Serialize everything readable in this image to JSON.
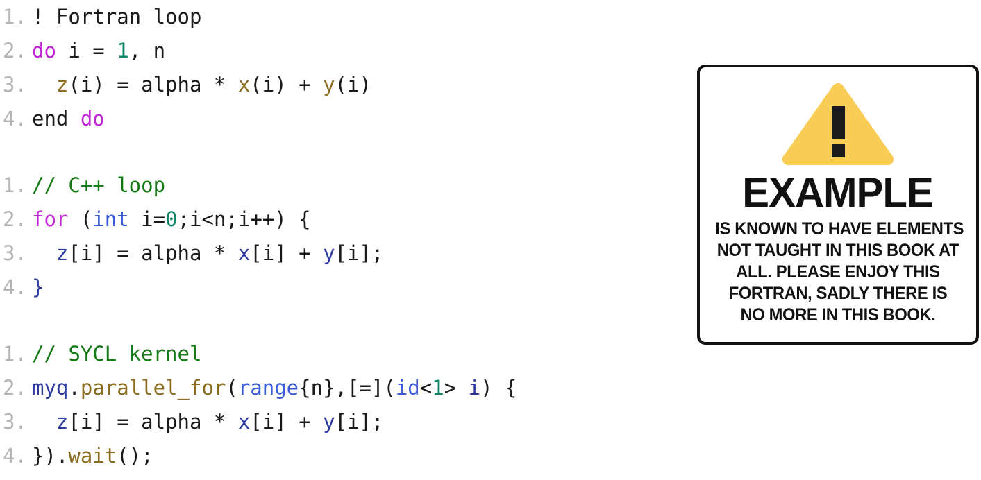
{
  "code": {
    "blocks": [
      {
        "name": "fortran-snippet",
        "language": "Fortran",
        "lines": [
          {
            "num": "1.",
            "tokens": [
              {
                "text": "! Fortran loop",
                "kind": "plain"
              }
            ]
          },
          {
            "num": "2.",
            "tokens": [
              {
                "text": "do",
                "kind": "keyword"
              },
              {
                "text": " i = ",
                "kind": "plain"
              },
              {
                "text": "1",
                "kind": "number"
              },
              {
                "text": ", n",
                "kind": "plain"
              }
            ]
          },
          {
            "num": "3.",
            "tokens": [
              {
                "text": "  ",
                "kind": "plain"
              },
              {
                "text": "z",
                "kind": "var-gold"
              },
              {
                "text": "(i) = alpha * ",
                "kind": "plain"
              },
              {
                "text": "x",
                "kind": "var-gold"
              },
              {
                "text": "(i) + ",
                "kind": "plain"
              },
              {
                "text": "y",
                "kind": "var-gold"
              },
              {
                "text": "(i)",
                "kind": "plain"
              }
            ]
          },
          {
            "num": "4.",
            "tokens": [
              {
                "text": "end ",
                "kind": "plain"
              },
              {
                "text": "do",
                "kind": "keyword"
              }
            ]
          }
        ]
      },
      {
        "name": "cpp-snippet",
        "language": "C++",
        "lines": [
          {
            "num": "1.",
            "tokens": [
              {
                "text": "// C++ loop",
                "kind": "comment"
              }
            ]
          },
          {
            "num": "2.",
            "tokens": [
              {
                "text": "for",
                "kind": "keyword"
              },
              {
                "text": " (",
                "kind": "plain"
              },
              {
                "text": "int",
                "kind": "type"
              },
              {
                "text": " i=",
                "kind": "plain"
              },
              {
                "text": "0",
                "kind": "number"
              },
              {
                "text": ";i<n;i++) {",
                "kind": "plain"
              }
            ]
          },
          {
            "num": "3.",
            "tokens": [
              {
                "text": "  ",
                "kind": "plain"
              },
              {
                "text": "z",
                "kind": "var-blue"
              },
              {
                "text": "[i] = alpha * ",
                "kind": "plain"
              },
              {
                "text": "x",
                "kind": "var-blue"
              },
              {
                "text": "[i] + ",
                "kind": "plain"
              },
              {
                "text": "y",
                "kind": "var-blue"
              },
              {
                "text": "[i];",
                "kind": "plain"
              }
            ]
          },
          {
            "num": "4.",
            "tokens": [
              {
                "text": "}",
                "kind": "punc-blue"
              }
            ]
          }
        ]
      },
      {
        "name": "sycl-snippet",
        "language": "SYCL",
        "lines": [
          {
            "num": "1.",
            "tokens": [
              {
                "text": "// SYCL kernel",
                "kind": "comment"
              }
            ]
          },
          {
            "num": "2.",
            "tokens": [
              {
                "text": "myq",
                "kind": "var-blue"
              },
              {
                "text": ".",
                "kind": "plain"
              },
              {
                "text": "parallel_for",
                "kind": "func"
              },
              {
                "text": "(",
                "kind": "plain"
              },
              {
                "text": "range",
                "kind": "type"
              },
              {
                "text": "{n},[=](",
                "kind": "plain"
              },
              {
                "text": "id",
                "kind": "type"
              },
              {
                "text": "<",
                "kind": "plain"
              },
              {
                "text": "1",
                "kind": "number"
              },
              {
                "text": "> ",
                "kind": "plain"
              },
              {
                "text": "i",
                "kind": "var-blue"
              },
              {
                "text": ") {",
                "kind": "plain"
              }
            ]
          },
          {
            "num": "3.",
            "tokens": [
              {
                "text": "  ",
                "kind": "plain"
              },
              {
                "text": "z",
                "kind": "var-blue"
              },
              {
                "text": "[i] = alpha * ",
                "kind": "plain"
              },
              {
                "text": "x",
                "kind": "var-blue"
              },
              {
                "text": "[i] + ",
                "kind": "plain"
              },
              {
                "text": "y",
                "kind": "var-blue"
              },
              {
                "text": "[i];",
                "kind": "plain"
              }
            ]
          },
          {
            "num": "4.",
            "tokens": [
              {
                "text": "})",
                "kind": "plain"
              },
              {
                "text": ".",
                "kind": "plain"
              },
              {
                "text": "wait",
                "kind": "func"
              },
              {
                "text": "();",
                "kind": "plain"
              }
            ]
          }
        ]
      }
    ]
  },
  "warning_card": {
    "icon": "warning-triangle-exclamation-icon",
    "title": "EXAMPLE",
    "body_lines": [
      "IS KNOWN TO HAVE ELEMENTS",
      "NOT TAUGHT IN THIS BOOK AT",
      "ALL. PLEASE ENJOY THIS",
      "FORTRAN, SADLY THERE IS",
      "NO MORE IN THIS BOOK."
    ],
    "colors": {
      "triangle": "#F8CC55",
      "mark": "#1a1a1a",
      "border": "#111111",
      "text": "#111111"
    }
  },
  "syntax_colors": {
    "plain": "#1a1a1a",
    "comment": "#157a15",
    "keyword": "#c026d3",
    "number": "#0d8468",
    "var-gold": "#8a6d21",
    "var-blue": "#2b3a9c",
    "type": "#3b5bd9",
    "func": "#8a6d21",
    "punc-blue": "#2b3a9c",
    "line-number": "#b4b4b4"
  }
}
